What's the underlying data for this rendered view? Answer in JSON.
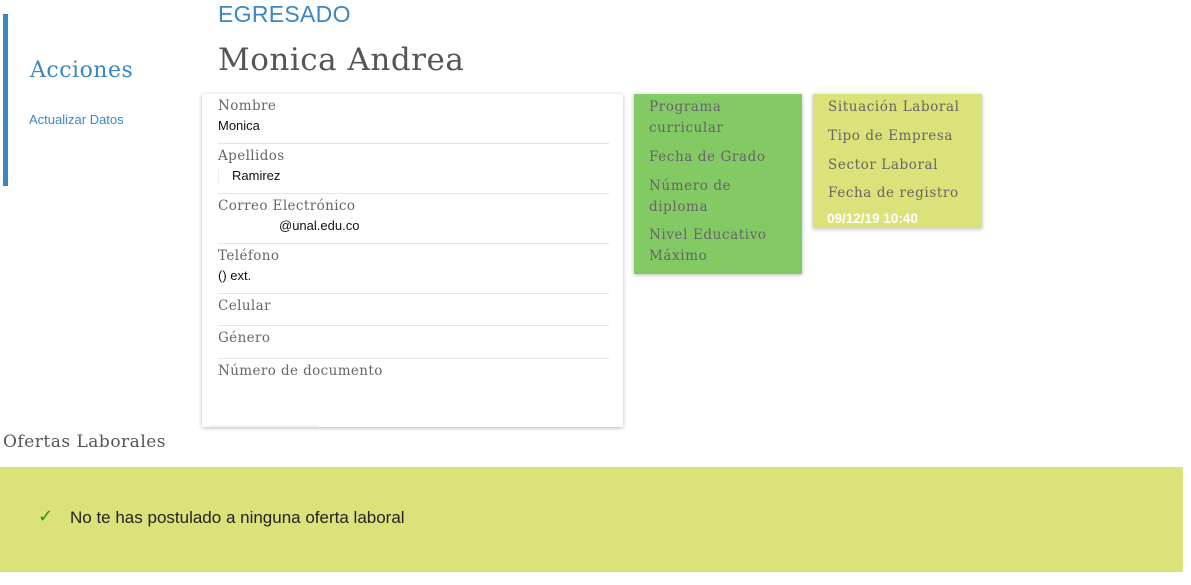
{
  "sidebar": {
    "title": "Acciones",
    "links": [
      "Actualizar Datos"
    ]
  },
  "profile": {
    "role": "EGRESADO",
    "name": "Monica Andrea"
  },
  "personal": {
    "nombre_label": "Nombre",
    "nombre_value": "Monica",
    "apellidos_label": "Apellidos",
    "apellidos_value": "Ramirez",
    "correo_label": "Correo Electrónico",
    "correo_value": "@unal.edu.co",
    "telefono_label": "Teléfono",
    "telefono_value": "() ext.",
    "celular_label": "Celular",
    "genero_label": "Género",
    "documento_label": "Número de documento"
  },
  "academic": {
    "programa_label": "Programa curricular",
    "fecha_grado_label": "Fecha de Grado",
    "diploma_label": "Número de diploma",
    "nivel_label": "Nivel Educativo Máximo"
  },
  "labor": {
    "situacion_label": "Situación Laboral",
    "tipo_empresa_label": "Tipo de Empresa",
    "sector_label": "Sector Laboral",
    "fecha_registro_label": "Fecha de registro",
    "fecha_registro_value": "09/12/19 10:40"
  },
  "offers": {
    "title": "Ofertas Laborales",
    "message": "No te has postulado a ninguna oferta laboral",
    "icon": "check-icon"
  },
  "colors": {
    "accent": "#3a87c4",
    "green_card": "#83c964",
    "yellow_card": "#dbe27a",
    "check": "#2d8f1e"
  }
}
